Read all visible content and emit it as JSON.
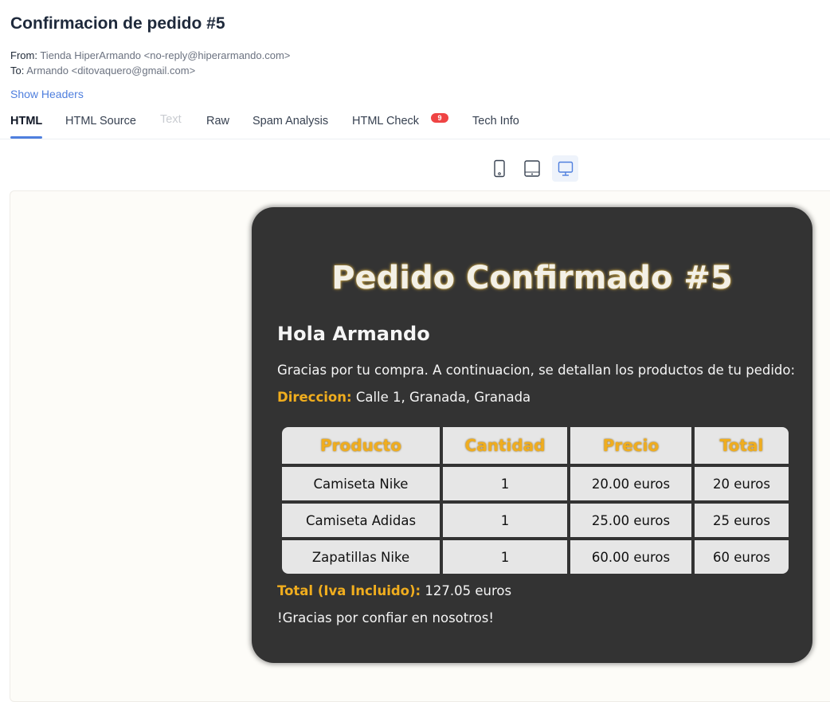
{
  "email": {
    "subject": "Confirmacion de pedido #5",
    "from_label": "From:",
    "from_value": "Tienda HiperArmando <no-reply@hiperarmando.com>",
    "to_label": "To:",
    "to_value": "Armando <ditovaquero@gmail.com>",
    "show_headers": "Show Headers"
  },
  "tabs": [
    {
      "label": "HTML",
      "state": "active"
    },
    {
      "label": "HTML Source",
      "state": "normal"
    },
    {
      "label": "Text",
      "state": "disabled"
    },
    {
      "label": "Raw",
      "state": "normal"
    },
    {
      "label": "Spam Analysis",
      "state": "normal"
    },
    {
      "label": "HTML Check",
      "state": "normal",
      "badge": "9"
    },
    {
      "label": "Tech Info",
      "state": "normal"
    }
  ],
  "device_toggle": [
    {
      "icon": "mobile-icon",
      "active": false
    },
    {
      "icon": "tablet-icon",
      "active": false
    },
    {
      "icon": "desktop-icon",
      "active": true
    }
  ],
  "colors": {
    "accent": "#4f7fde",
    "card_bg": "#333333",
    "gold": "#f0ad1e",
    "badge": "#ef4444"
  },
  "message": {
    "title": "Pedido Confirmado #5",
    "greeting": "Hola Armando",
    "intro": "Gracias por tu compra. A continuacion, se detallan los productos de tu pedido:",
    "address_label": "Direccion:",
    "address_value": "Calle 1, Granada, Granada",
    "table": {
      "headers": [
        "Producto",
        "Cantidad",
        "Precio",
        "Total"
      ],
      "rows": [
        [
          "Camiseta Nike",
          "1",
          "20.00 euros",
          "20 euros"
        ],
        [
          "Camiseta Adidas",
          "1",
          "25.00 euros",
          "25 euros"
        ],
        [
          "Zapatillas Nike",
          "1",
          "60.00 euros",
          "60 euros"
        ]
      ]
    },
    "total_label": "Total (Iva Incluido):",
    "total_value": "127.05 euros",
    "closing": "!Gracias por confiar en nosotros!"
  }
}
